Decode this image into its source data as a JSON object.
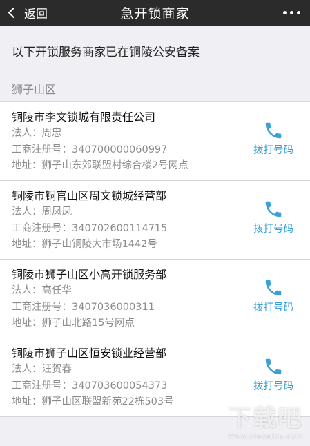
{
  "nav": {
    "back_label": "返回",
    "title": "急开锁商家"
  },
  "notice": "以下开锁服务商家已在铜陵公安备案",
  "district": "狮子山区",
  "call_label": "拨打号码",
  "colors": {
    "nav_bg": "#2b2b2b",
    "accent": "#3aa0d8",
    "page_bg": "#efeff4"
  },
  "merchants": [
    {
      "name": "铜陵市李文锁城有限责任公司",
      "legal": "法人：周忠",
      "reg": "工商注册号：340700000060997",
      "addr": "地址：狮子山东郊联盟村综合楼2号网点"
    },
    {
      "name": "铜陵市铜官山区周文锁城经营部",
      "legal": "法人：周凤凤",
      "reg": "工商注册号：340702600114715",
      "addr": "地址：狮子山铜陵大市场1442号"
    },
    {
      "name": "铜陵市狮子山区小高开锁服务部",
      "legal": "法人：高任华",
      "reg": "工商注册号：3407036000311",
      "addr": "地址：狮子山北路15号网点"
    },
    {
      "name": "铜陵市狮子山区恒安锁业经营部",
      "legal": "法人：汪贺春",
      "reg": "工商注册号：340703600054373",
      "addr": "地址：狮子山区联盟新苑22栋503号"
    }
  ],
  "watermark": {
    "main": "下载吧",
    "sub": "www.xiazaiba.com"
  }
}
